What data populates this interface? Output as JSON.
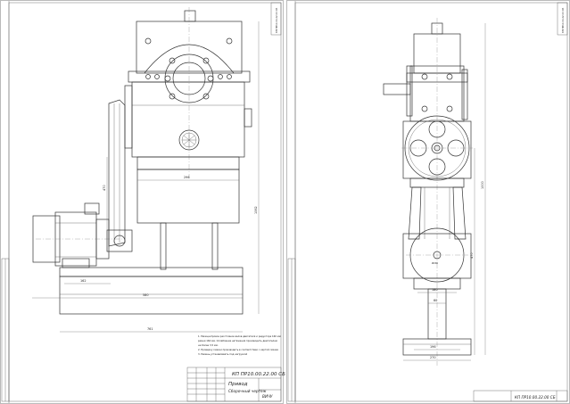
{
  "sheet1": {
    "vertical_code": "КП ПР10.00.22.00 СБ",
    "notes": [
      "1. Межцентровое расстояние валов двигателя и редуктора 160 мм",
      "ремня 160 мм. Ослабление натяжения производить двигателем",
      "не более 3,5 мм.",
      "2. Проверку смазки производить в соответствии с картой смазки",
      "3. Ремень устанавливать под нагрузкой"
    ],
    "title_code": "КП ПР10.00.22.00 СБ",
    "title_name": "Привод",
    "title_sub": "Сборочный чертеж",
    "group": "ВИЧУ",
    "dims": {
      "d_width_top": "296",
      "d_width_mid": "162",
      "d_width_base": "580",
      "d_width_bottom": "761",
      "d_height_total": "1062",
      "d_height_side": "470"
    }
  },
  "sheet2": {
    "vertical_code": "КП ПР10.00.22.00 СБ",
    "title_code": "КП ПР10.00.22.00 СБ",
    "dims": {
      "d_height_total": "1000",
      "d_height_mid": "470",
      "d_circle": "Ø200",
      "d_width_a": "180",
      "d_width_b": "196",
      "d_width_c": "270",
      "d_small": "60"
    }
  }
}
